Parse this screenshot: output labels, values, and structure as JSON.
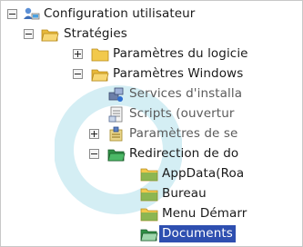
{
  "tree": {
    "root": {
      "label": "Configuration utilisateur",
      "icon": "user-config-icon"
    },
    "strategies": {
      "label": "Stratégies",
      "icon": "folder-open-icon"
    },
    "params_logiciel": {
      "label": "Paramètres du logicie",
      "icon": "folder-icon"
    },
    "params_windows": {
      "label": "Paramètres Windows",
      "icon": "folder-open-icon"
    },
    "services_install": {
      "label": "Services d'installa",
      "icon": "services-icon"
    },
    "scripts": {
      "label": "Scripts (ouvertur",
      "icon": "script-icon"
    },
    "params_se": {
      "label": "Paramètres de se",
      "icon": "settings-icon"
    },
    "redirection": {
      "label": "Redirection de do",
      "icon": "folder-open-icon"
    },
    "appdata": {
      "label": "AppData(Roa",
      "icon": "folder-icon"
    },
    "bureau": {
      "label": "Bureau",
      "icon": "folder-icon"
    },
    "menu_demarrer": {
      "label": "Menu Démarr",
      "icon": "folder-icon"
    },
    "documents": {
      "label": "Documents",
      "icon": "folder-open-icon",
      "selected": true
    }
  },
  "colors": {
    "selection": "#2e4fb0",
    "folder": "#f2c94c",
    "redirect_folder": "#3aa655"
  }
}
